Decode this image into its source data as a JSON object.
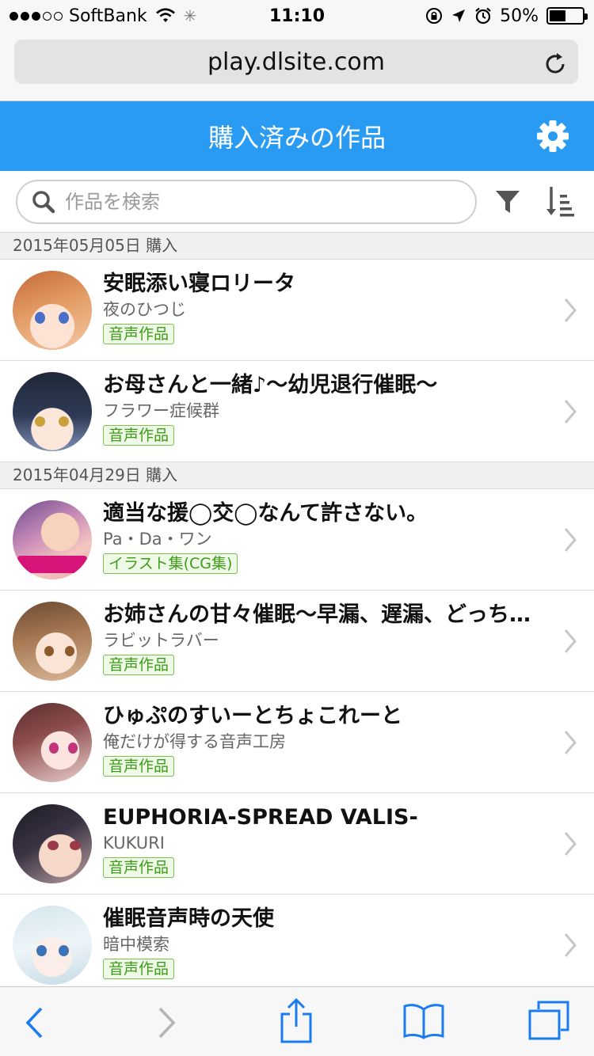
{
  "status_bar": {
    "carrier": "SoftBank",
    "time": "11:10",
    "battery": "50%",
    "battery_level": 0.5
  },
  "browser": {
    "url": "play.dlsite.com"
  },
  "header": {
    "title": "購入済みの作品"
  },
  "search": {
    "placeholder": "作品を検索"
  },
  "sections": [
    {
      "date": "2015年05月05日 購入",
      "items": [
        {
          "title": "安眠添い寝ロリータ",
          "author": "夜のひつじ",
          "category": "音声作品"
        },
        {
          "title": "お母さんと一緒♪〜幼児退行催眠〜",
          "author": "フラワー症候群",
          "category": "音声作品"
        }
      ]
    },
    {
      "date": "2015年04月29日 購入",
      "items": [
        {
          "title": "適当な援◯交◯なんて許さない。",
          "author": "Pa・Da・ワン",
          "category": "イラスト集(CG集)"
        },
        {
          "title": "お姉さんの甘々催眠〜早漏、遅漏、どっち…",
          "author": "ラビットラバー",
          "category": "音声作品"
        },
        {
          "title": "ひゅぷのすいーとちょこれーと",
          "author": "俺だけが得する音声工房",
          "category": "音声作品"
        },
        {
          "title": "EUPHORIA-SPREAD VALIS-",
          "author": "KUKURI",
          "category": "音声作品"
        },
        {
          "title": "催眠音声時の天使",
          "author": "暗中模索",
          "category": "音声作品"
        }
      ]
    }
  ],
  "colors": {
    "header_bg": "#2a9bf2",
    "toolbar_icon": "#1a7cf0",
    "badge_green": "#3f9b1a"
  }
}
